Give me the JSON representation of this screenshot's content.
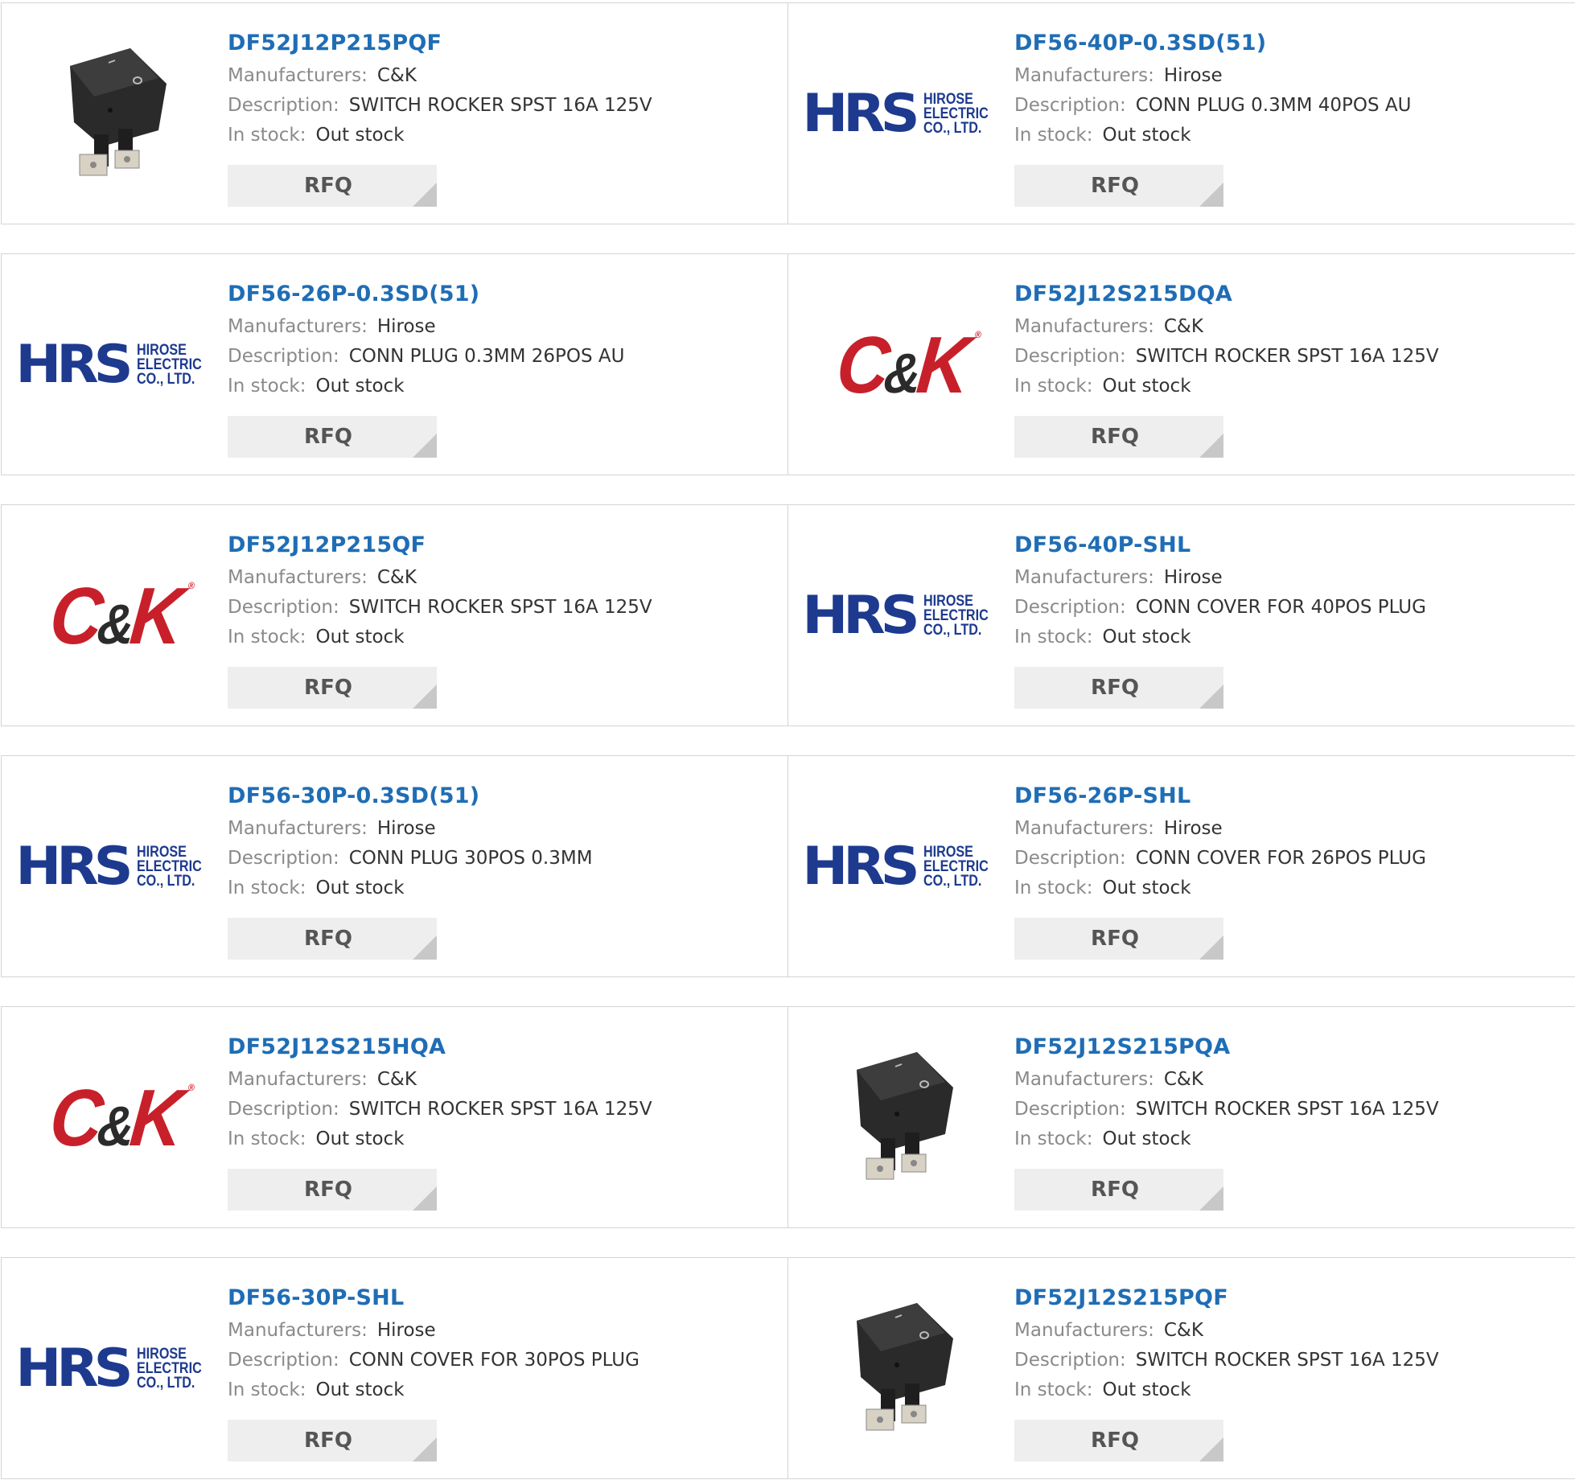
{
  "labels": {
    "manufacturers": "Manufacturers:",
    "description": "Description:",
    "stock": "In stock:",
    "rfq": "RFQ"
  },
  "products": [
    {
      "part": "DF52J12P215PQF",
      "manufacturer": "C&K",
      "description": "SWITCH ROCKER SPST 16A 125V",
      "stock": "Out stock",
      "image": "rocker-switch-photo"
    },
    {
      "part": "DF56-40P-0.3SD(51)",
      "manufacturer": "Hirose",
      "description": "CONN PLUG 0.3MM 40POS AU",
      "stock": "Out stock",
      "image": "hrs-logo"
    },
    {
      "part": "DF56-26P-0.3SD(51)",
      "manufacturer": "Hirose",
      "description": "CONN PLUG 0.3MM 26POS AU",
      "stock": "Out stock",
      "image": "hrs-logo"
    },
    {
      "part": "DF52J12S215DQA",
      "manufacturer": "C&K",
      "description": "SWITCH ROCKER SPST 16A 125V",
      "stock": "Out stock",
      "image": "ck-logo"
    },
    {
      "part": "DF52J12P215QF",
      "manufacturer": "C&K",
      "description": "SWITCH ROCKER SPST 16A 125V",
      "stock": "Out stock",
      "image": "ck-logo"
    },
    {
      "part": "DF56-40P-SHL",
      "manufacturer": "Hirose",
      "description": "CONN COVER FOR 40POS PLUG",
      "stock": "Out stock",
      "image": "hrs-logo"
    },
    {
      "part": "DF56-30P-0.3SD(51)",
      "manufacturer": "Hirose",
      "description": "CONN PLUG 30POS 0.3MM",
      "stock": "Out stock",
      "image": "hrs-logo"
    },
    {
      "part": "DF56-26P-SHL",
      "manufacturer": "Hirose",
      "description": "CONN COVER FOR 26POS PLUG",
      "stock": "Out stock",
      "image": "hrs-logo"
    },
    {
      "part": "DF52J12S215HQA",
      "manufacturer": "C&K",
      "description": "SWITCH ROCKER SPST 16A 125V",
      "stock": "Out stock",
      "image": "ck-logo"
    },
    {
      "part": "DF52J12S215PQA",
      "manufacturer": "C&K",
      "description": "SWITCH ROCKER SPST 16A 125V",
      "stock": "Out stock",
      "image": "rocker-switch-photo"
    },
    {
      "part": "DF56-30P-SHL",
      "manufacturer": "Hirose",
      "description": "CONN COVER FOR 30POS PLUG",
      "stock": "Out stock",
      "image": "hrs-logo"
    },
    {
      "part": "DF52J12S215PQF",
      "manufacturer": "C&K",
      "description": "SWITCH ROCKER SPST 16A 125V",
      "stock": "Out stock",
      "image": "rocker-switch-photo"
    }
  ],
  "logos": {
    "hrs_mark": "HRS",
    "hrs_line1": "HIROSE",
    "hrs_line2": "ELECTRIC",
    "hrs_line3": "CO., LTD.",
    "ck_c": "C",
    "ck_amp": "&",
    "ck_k": "K",
    "ck_reg": "®"
  },
  "colors": {
    "link": "#1f6db5",
    "hrs_blue": "#1d3a8f",
    "ck_red": "#c8202a",
    "rfq_bg": "#eeeeee"
  }
}
